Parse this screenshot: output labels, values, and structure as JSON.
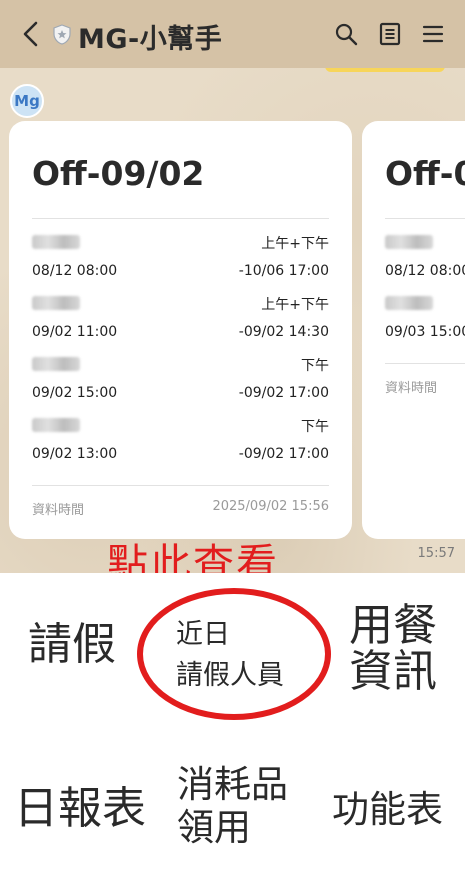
{
  "header": {
    "title": "MG-小幫手"
  },
  "avatar": {
    "text": "Mg"
  },
  "cards": [
    {
      "title": "Off-09/02",
      "rows": [
        {
          "period": "上午+下午",
          "start": "08/12 08:00",
          "end": "-10/06 17:00"
        },
        {
          "period": "上午+下午",
          "start": "09/02 11:00",
          "end": "-09/02 14:30"
        },
        {
          "period": "下午",
          "start": "09/02 15:00",
          "end": "-09/02 17:00"
        },
        {
          "period": "下午",
          "start": "09/02 13:00",
          "end": "-09/02 17:00"
        }
      ],
      "footer_label": "資料時間",
      "footer_time": "2025/09/02 15:56"
    },
    {
      "title": "Off-0",
      "rows": [
        {
          "start": "08/12 08:00"
        },
        {
          "start": "09/03 15:00"
        }
      ],
      "footer_label": "資料時間"
    }
  ],
  "message_time": "15:57",
  "annotation": "點此查看",
  "menu": {
    "leave": "請假",
    "recent_line1": "近日",
    "recent_line2": "請假人員",
    "meal_line1": "用餐",
    "meal_line2": "資訊",
    "daily_report": "日報表",
    "supplies_line1": "消耗品",
    "supplies_line2": "領用",
    "function_table": "功能表"
  },
  "colors": {
    "header_bg": "#d5c2a6",
    "annotation_red": "#e21d1d"
  },
  "icons": [
    "back-arrow-icon",
    "shield-icon",
    "search-icon",
    "notes-icon",
    "menu-icon"
  ]
}
